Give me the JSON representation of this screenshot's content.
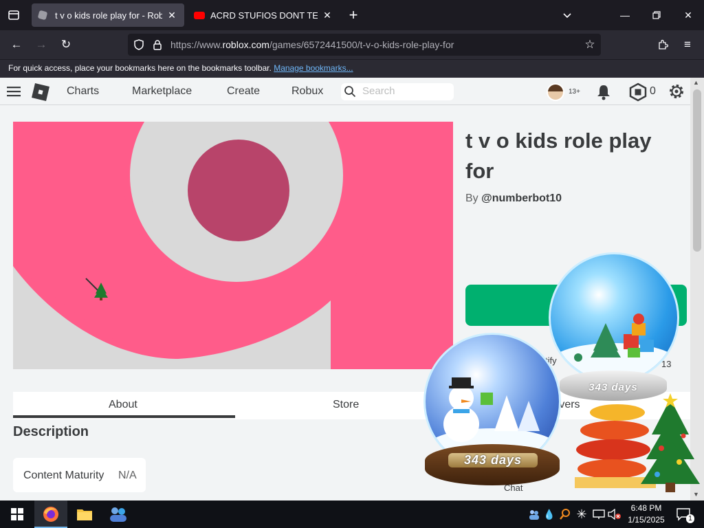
{
  "browser": {
    "tabs": [
      {
        "title": "t v o kids role play for - Roblox",
        "active": true
      },
      {
        "title": "ACRD STUFIOS DONT TERMINA",
        "active": false
      }
    ],
    "url_prefix": "https://www.",
    "url_domain": "roblox.com",
    "url_path": "/games/6572441500/t-v-o-kids-role-play-for",
    "bookmarks_msg": "For quick access, place your bookmarks here on the bookmarks toolbar.",
    "bookmarks_link": "Manage bookmarks..."
  },
  "roblox_header": {
    "nav": [
      "Charts",
      "Marketplace",
      "Create",
      "Robux"
    ],
    "search_placeholder": "Search",
    "age_badge": "13+",
    "robux_count": "0"
  },
  "game": {
    "title": "t v o kids role play for",
    "by_label": "By",
    "creator": "@numberbot10",
    "tabs": [
      "About",
      "Store",
      "rvers"
    ],
    "description_heading": "Description",
    "content_maturity_label": "Content Maturity",
    "content_maturity_value": "N/A",
    "obscured_text": [
      "tify",
      "13",
      "Chat"
    ]
  },
  "overlay": {
    "days_label": "343 days"
  },
  "taskbar": {
    "time": "6:48 PM",
    "date": "1/15/2025",
    "notification_count": "1"
  },
  "colors": {
    "play_green": "#00b06f",
    "thumb_pink": "#ff5c8a",
    "thumb_dark": "#b8446a",
    "roblox_bg": "#f2f4f5"
  }
}
